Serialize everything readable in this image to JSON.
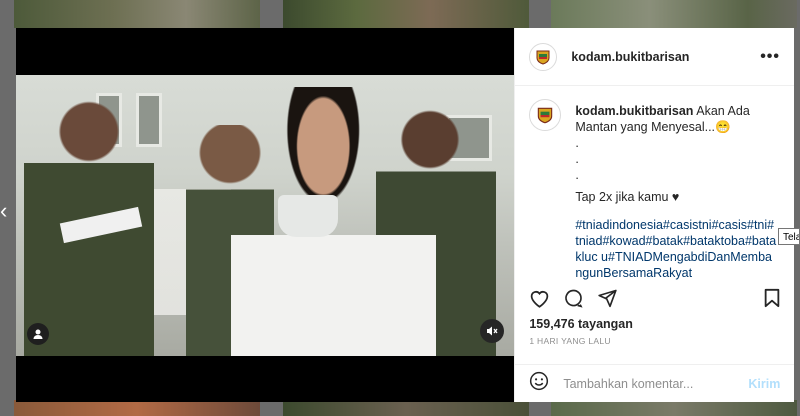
{
  "post": {
    "username": "kodam.bukitbarisan",
    "caption_lines": [
      "Akan Ada",
      "Mantan yang Menyesal...",
      ".",
      ".",
      ".",
      "Tap 2x jika kamu ♥"
    ],
    "hashtags": "#tniadindonesia#casistni#casis#tni#tniad#kowad#batak#bataktoba#batakluc u#TNIADMengabdiDanMembangunBersamaRakyat",
    "emoji_label": "😁",
    "views": "159,476 tayangan",
    "date": "1 HARI YANG LALU",
    "comment_placeholder": "Tambahkan komentar...",
    "post_label": "Kirim",
    "more_label": "•••"
  },
  "tooltip": {
    "text": "Telah"
  },
  "icons": {
    "like": "heart-icon",
    "comment": "comment-icon",
    "share": "share-icon",
    "save": "bookmark-icon",
    "emoji": "emoji-icon",
    "user_tag": "user-icon",
    "mute": "speaker-muted-icon"
  },
  "colors": {
    "link": "#00376b",
    "post_button": "#b2dffc",
    "text": "#262626",
    "muted": "#8e8e8e"
  }
}
